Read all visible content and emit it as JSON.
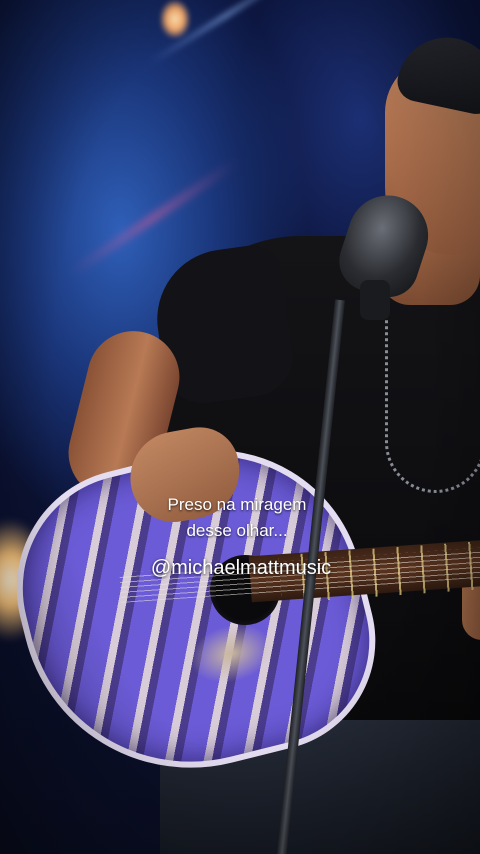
{
  "video": {
    "caption_lines": [
      "Preso na miragem",
      "desse olhar..."
    ],
    "handle": "@michaelmattmusic"
  },
  "colors": {
    "caption_text": "#ffffff",
    "guitar_accent": "#6b5bd6",
    "background_blue": "#1a3579"
  }
}
